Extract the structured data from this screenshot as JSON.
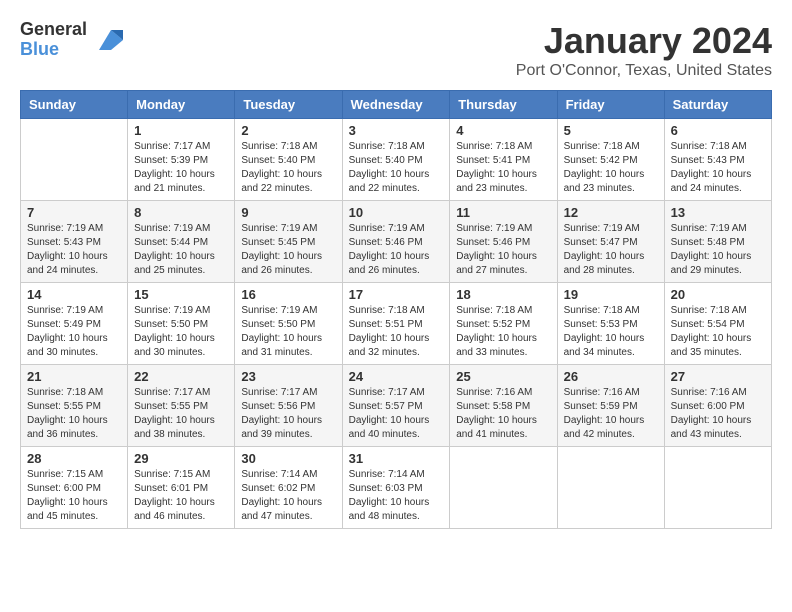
{
  "logo": {
    "line1": "General",
    "line2": "Blue"
  },
  "title": "January 2024",
  "location": "Port O'Connor, Texas, United States",
  "weekdays": [
    "Sunday",
    "Monday",
    "Tuesday",
    "Wednesday",
    "Thursday",
    "Friday",
    "Saturday"
  ],
  "weeks": [
    [
      {
        "day": "",
        "sunrise": "",
        "sunset": "",
        "daylight": ""
      },
      {
        "day": "1",
        "sunrise": "Sunrise: 7:17 AM",
        "sunset": "Sunset: 5:39 PM",
        "daylight": "Daylight: 10 hours and 21 minutes."
      },
      {
        "day": "2",
        "sunrise": "Sunrise: 7:18 AM",
        "sunset": "Sunset: 5:40 PM",
        "daylight": "Daylight: 10 hours and 22 minutes."
      },
      {
        "day": "3",
        "sunrise": "Sunrise: 7:18 AM",
        "sunset": "Sunset: 5:40 PM",
        "daylight": "Daylight: 10 hours and 22 minutes."
      },
      {
        "day": "4",
        "sunrise": "Sunrise: 7:18 AM",
        "sunset": "Sunset: 5:41 PM",
        "daylight": "Daylight: 10 hours and 23 minutes."
      },
      {
        "day": "5",
        "sunrise": "Sunrise: 7:18 AM",
        "sunset": "Sunset: 5:42 PM",
        "daylight": "Daylight: 10 hours and 23 minutes."
      },
      {
        "day": "6",
        "sunrise": "Sunrise: 7:18 AM",
        "sunset": "Sunset: 5:43 PM",
        "daylight": "Daylight: 10 hours and 24 minutes."
      }
    ],
    [
      {
        "day": "7",
        "sunrise": "Sunrise: 7:19 AM",
        "sunset": "Sunset: 5:43 PM",
        "daylight": "Daylight: 10 hours and 24 minutes."
      },
      {
        "day": "8",
        "sunrise": "Sunrise: 7:19 AM",
        "sunset": "Sunset: 5:44 PM",
        "daylight": "Daylight: 10 hours and 25 minutes."
      },
      {
        "day": "9",
        "sunrise": "Sunrise: 7:19 AM",
        "sunset": "Sunset: 5:45 PM",
        "daylight": "Daylight: 10 hours and 26 minutes."
      },
      {
        "day": "10",
        "sunrise": "Sunrise: 7:19 AM",
        "sunset": "Sunset: 5:46 PM",
        "daylight": "Daylight: 10 hours and 26 minutes."
      },
      {
        "day": "11",
        "sunrise": "Sunrise: 7:19 AM",
        "sunset": "Sunset: 5:46 PM",
        "daylight": "Daylight: 10 hours and 27 minutes."
      },
      {
        "day": "12",
        "sunrise": "Sunrise: 7:19 AM",
        "sunset": "Sunset: 5:47 PM",
        "daylight": "Daylight: 10 hours and 28 minutes."
      },
      {
        "day": "13",
        "sunrise": "Sunrise: 7:19 AM",
        "sunset": "Sunset: 5:48 PM",
        "daylight": "Daylight: 10 hours and 29 minutes."
      }
    ],
    [
      {
        "day": "14",
        "sunrise": "Sunrise: 7:19 AM",
        "sunset": "Sunset: 5:49 PM",
        "daylight": "Daylight: 10 hours and 30 minutes."
      },
      {
        "day": "15",
        "sunrise": "Sunrise: 7:19 AM",
        "sunset": "Sunset: 5:50 PM",
        "daylight": "Daylight: 10 hours and 30 minutes."
      },
      {
        "day": "16",
        "sunrise": "Sunrise: 7:19 AM",
        "sunset": "Sunset: 5:50 PM",
        "daylight": "Daylight: 10 hours and 31 minutes."
      },
      {
        "day": "17",
        "sunrise": "Sunrise: 7:18 AM",
        "sunset": "Sunset: 5:51 PM",
        "daylight": "Daylight: 10 hours and 32 minutes."
      },
      {
        "day": "18",
        "sunrise": "Sunrise: 7:18 AM",
        "sunset": "Sunset: 5:52 PM",
        "daylight": "Daylight: 10 hours and 33 minutes."
      },
      {
        "day": "19",
        "sunrise": "Sunrise: 7:18 AM",
        "sunset": "Sunset: 5:53 PM",
        "daylight": "Daylight: 10 hours and 34 minutes."
      },
      {
        "day": "20",
        "sunrise": "Sunrise: 7:18 AM",
        "sunset": "Sunset: 5:54 PM",
        "daylight": "Daylight: 10 hours and 35 minutes."
      }
    ],
    [
      {
        "day": "21",
        "sunrise": "Sunrise: 7:18 AM",
        "sunset": "Sunset: 5:55 PM",
        "daylight": "Daylight: 10 hours and 36 minutes."
      },
      {
        "day": "22",
        "sunrise": "Sunrise: 7:17 AM",
        "sunset": "Sunset: 5:55 PM",
        "daylight": "Daylight: 10 hours and 38 minutes."
      },
      {
        "day": "23",
        "sunrise": "Sunrise: 7:17 AM",
        "sunset": "Sunset: 5:56 PM",
        "daylight": "Daylight: 10 hours and 39 minutes."
      },
      {
        "day": "24",
        "sunrise": "Sunrise: 7:17 AM",
        "sunset": "Sunset: 5:57 PM",
        "daylight": "Daylight: 10 hours and 40 minutes."
      },
      {
        "day": "25",
        "sunrise": "Sunrise: 7:16 AM",
        "sunset": "Sunset: 5:58 PM",
        "daylight": "Daylight: 10 hours and 41 minutes."
      },
      {
        "day": "26",
        "sunrise": "Sunrise: 7:16 AM",
        "sunset": "Sunset: 5:59 PM",
        "daylight": "Daylight: 10 hours and 42 minutes."
      },
      {
        "day": "27",
        "sunrise": "Sunrise: 7:16 AM",
        "sunset": "Sunset: 6:00 PM",
        "daylight": "Daylight: 10 hours and 43 minutes."
      }
    ],
    [
      {
        "day": "28",
        "sunrise": "Sunrise: 7:15 AM",
        "sunset": "Sunset: 6:00 PM",
        "daylight": "Daylight: 10 hours and 45 minutes."
      },
      {
        "day": "29",
        "sunrise": "Sunrise: 7:15 AM",
        "sunset": "Sunset: 6:01 PM",
        "daylight": "Daylight: 10 hours and 46 minutes."
      },
      {
        "day": "30",
        "sunrise": "Sunrise: 7:14 AM",
        "sunset": "Sunset: 6:02 PM",
        "daylight": "Daylight: 10 hours and 47 minutes."
      },
      {
        "day": "31",
        "sunrise": "Sunrise: 7:14 AM",
        "sunset": "Sunset: 6:03 PM",
        "daylight": "Daylight: 10 hours and 48 minutes."
      },
      {
        "day": "",
        "sunrise": "",
        "sunset": "",
        "daylight": ""
      },
      {
        "day": "",
        "sunrise": "",
        "sunset": "",
        "daylight": ""
      },
      {
        "day": "",
        "sunrise": "",
        "sunset": "",
        "daylight": ""
      }
    ]
  ]
}
